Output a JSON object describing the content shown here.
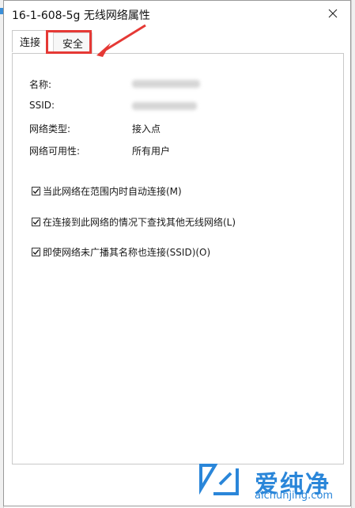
{
  "window": {
    "title": "16-1-608-5g 无线网络属性"
  },
  "tabs": [
    {
      "label": "连接"
    },
    {
      "label": "安全"
    }
  ],
  "fields": [
    {
      "label": "名称:",
      "value": ""
    },
    {
      "label": "SSID:",
      "value": ""
    },
    {
      "label": "网络类型:",
      "value": "接入点"
    },
    {
      "label": "网络可用性:",
      "value": "所有用户"
    }
  ],
  "checkboxes": [
    {
      "label": "当此网络在范围内时自动连接(M)",
      "checked": true
    },
    {
      "label": "在连接到此网络的情况下查找其他无线网络(L)",
      "checked": true
    },
    {
      "label": "即使网络未广播其名称也连接(SSID)(O)",
      "checked": true
    }
  ],
  "watermark": {
    "brand": "爱纯净",
    "url": "aichunjing.com"
  },
  "colors": {
    "highlight": "#e53935",
    "watermark": "#2a86d9"
  }
}
